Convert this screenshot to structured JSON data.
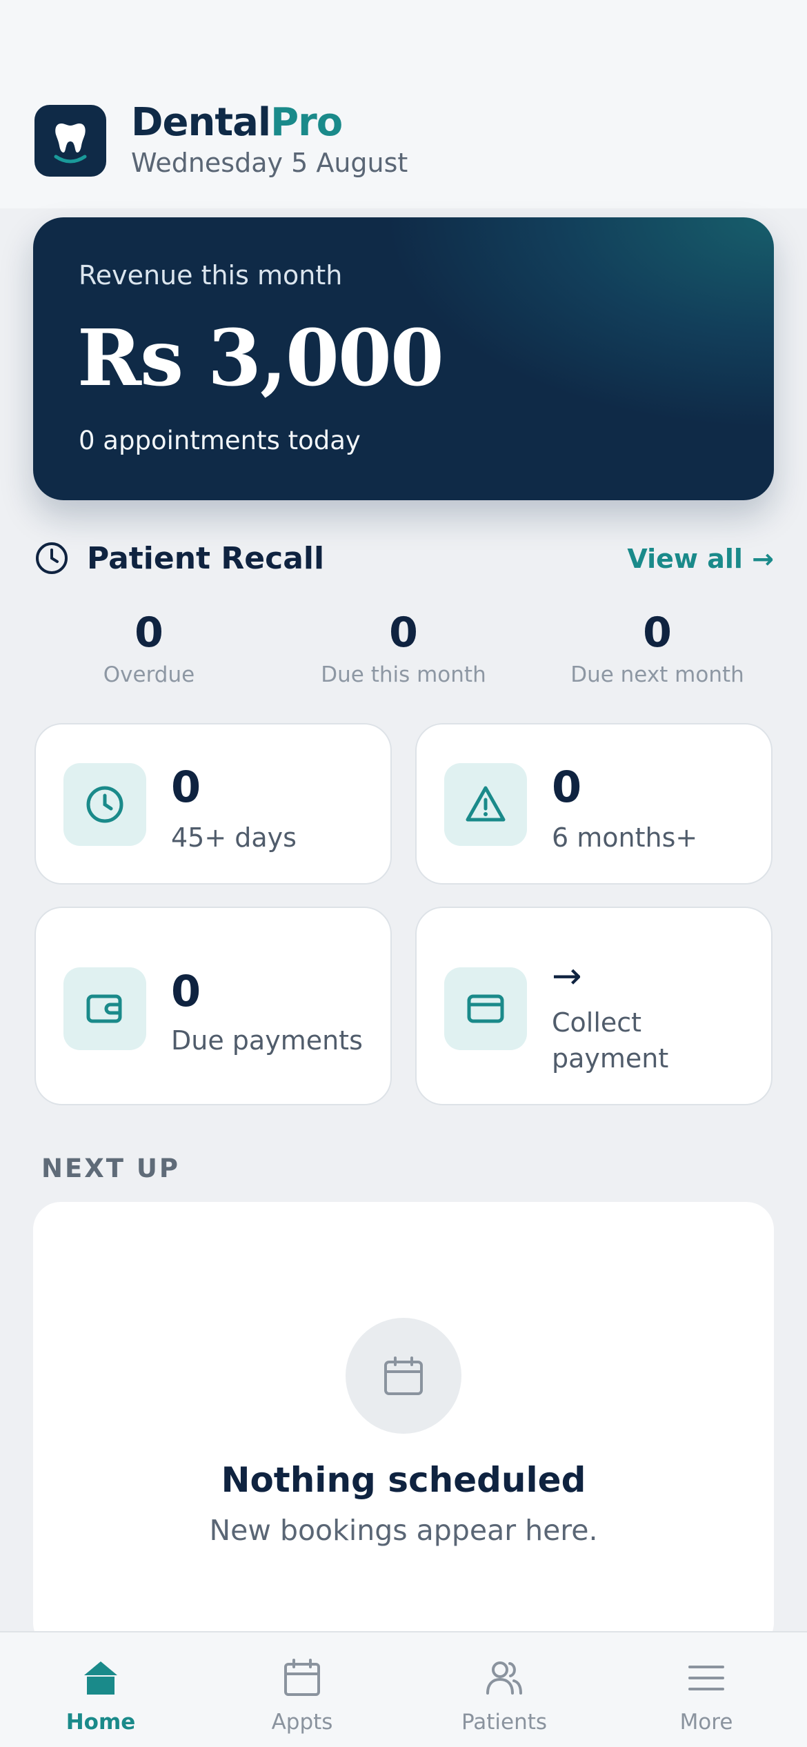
{
  "header": {
    "brand_part1": "Dental",
    "brand_part2": "Pro",
    "date": "Wednesday 5 August",
    "logo_icon": "tooth-icon"
  },
  "revenue": {
    "label": "Revenue this month",
    "amount": "Rs 3,000",
    "appointments": "0 appointments today"
  },
  "recall": {
    "title": "Patient Recall",
    "view_all": "View all →",
    "stats": [
      {
        "value": "0",
        "label": "Overdue"
      },
      {
        "value": "0",
        "label": "Due this month"
      },
      {
        "value": "0",
        "label": "Due next month"
      }
    ]
  },
  "cards": [
    {
      "icon": "clock-icon",
      "value": "0",
      "label": "45+ days"
    },
    {
      "icon": "alert-triangle-icon",
      "value": "0",
      "label": "6 months+"
    },
    {
      "icon": "wallet-icon",
      "value": "0",
      "label": "Due payments"
    },
    {
      "icon": "credit-card-icon",
      "value": "→",
      "label_line1": "Collect",
      "label_line2": "payment"
    }
  ],
  "next_up": {
    "section_label": "NEXT UP",
    "empty_title": "Nothing scheduled",
    "empty_sub": "New bookings appear here."
  },
  "nav": [
    {
      "label": "Home",
      "icon": "home-icon",
      "active": true
    },
    {
      "label": "Appts",
      "icon": "calendar-icon",
      "active": false
    },
    {
      "label": "Patients",
      "icon": "users-icon",
      "active": false
    },
    {
      "label": "More",
      "icon": "menu-icon",
      "active": false
    }
  ],
  "colors": {
    "navy": "#0f2a47",
    "teal": "#1a8a8a",
    "icon_bg": "#e0f1f1",
    "background": "#eef0f3"
  }
}
